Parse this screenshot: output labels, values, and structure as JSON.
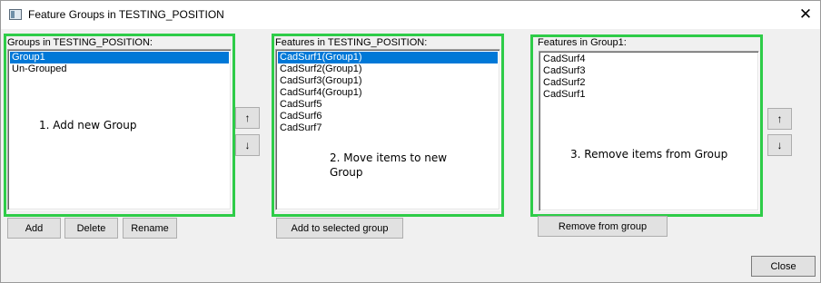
{
  "window": {
    "title": "Feature Groups in TESTING_POSITION",
    "close_glyph": "✕"
  },
  "groups_panel": {
    "label": "Groups in TESTING_POSITION:",
    "items": [
      "Group1",
      "Un-Grouped"
    ],
    "selected_index": 0,
    "note": "1. Add new Group",
    "buttons": {
      "add": "Add",
      "delete": "Delete",
      "rename": "Rename"
    }
  },
  "features_panel": {
    "label": "Features in TESTING_POSITION:",
    "items": [
      "CadSurf1(Group1)",
      "CadSurf2(Group1)",
      "CadSurf3(Group1)",
      "CadSurf4(Group1)",
      "CadSurf5",
      "CadSurf6",
      "CadSurf7"
    ],
    "selected_index": 0,
    "note_line1": "2. Move items to new",
    "note_line2": "Group",
    "buttons": {
      "add_to_group": "Add to selected group"
    }
  },
  "group_features_panel": {
    "label": "Features in Group1:",
    "items": [
      "CadSurf4",
      "CadSurf3",
      "CadSurf2",
      "CadSurf1"
    ],
    "note": "3. Remove items from Group",
    "buttons": {
      "remove": "Remove from group"
    }
  },
  "arrows": {
    "up": "↑",
    "down": "↓"
  },
  "footer": {
    "close": "Close"
  },
  "colors": {
    "highlight_box": "#2ecc48",
    "selection": "#0078d7"
  }
}
